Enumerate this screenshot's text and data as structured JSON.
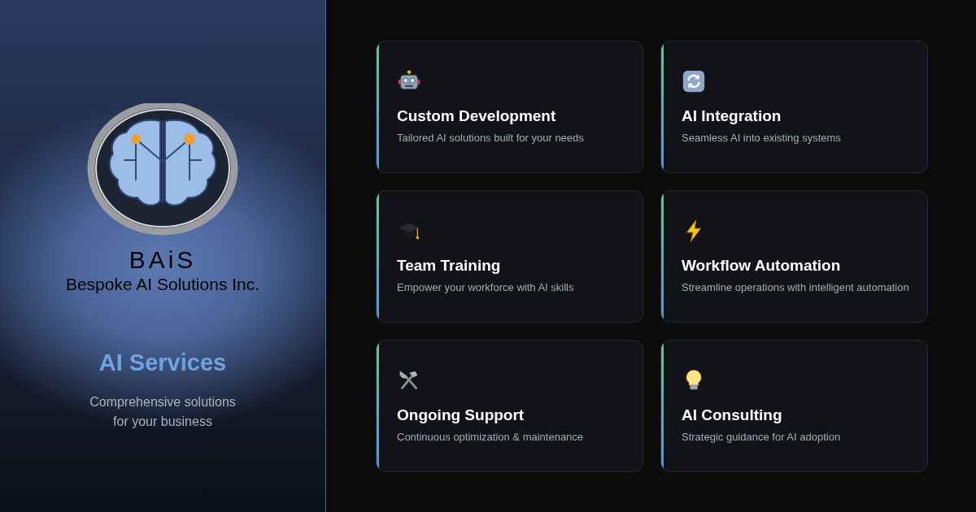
{
  "logo": {
    "wordmark": "BAiS",
    "company": "Bespoke AI Solutions Inc."
  },
  "heading": "AI Services",
  "subheading": "Comprehensive solutions for your business",
  "services": [
    {
      "title": "Custom Development",
      "description": "Tailored AI solutions built for your needs"
    },
    {
      "title": "AI Integration",
      "description": "Seamless AI into existing systems"
    },
    {
      "title": "Team Training",
      "description": "Empower your workforce with AI skills"
    },
    {
      "title": "Workflow Automation",
      "description": "Streamline operations with intelligent automation"
    },
    {
      "title": "Ongoing Support",
      "description": "Continuous optimization & maintenance"
    },
    {
      "title": "AI Consulting",
      "description": "Strategic guidance for AI adoption"
    }
  ]
}
